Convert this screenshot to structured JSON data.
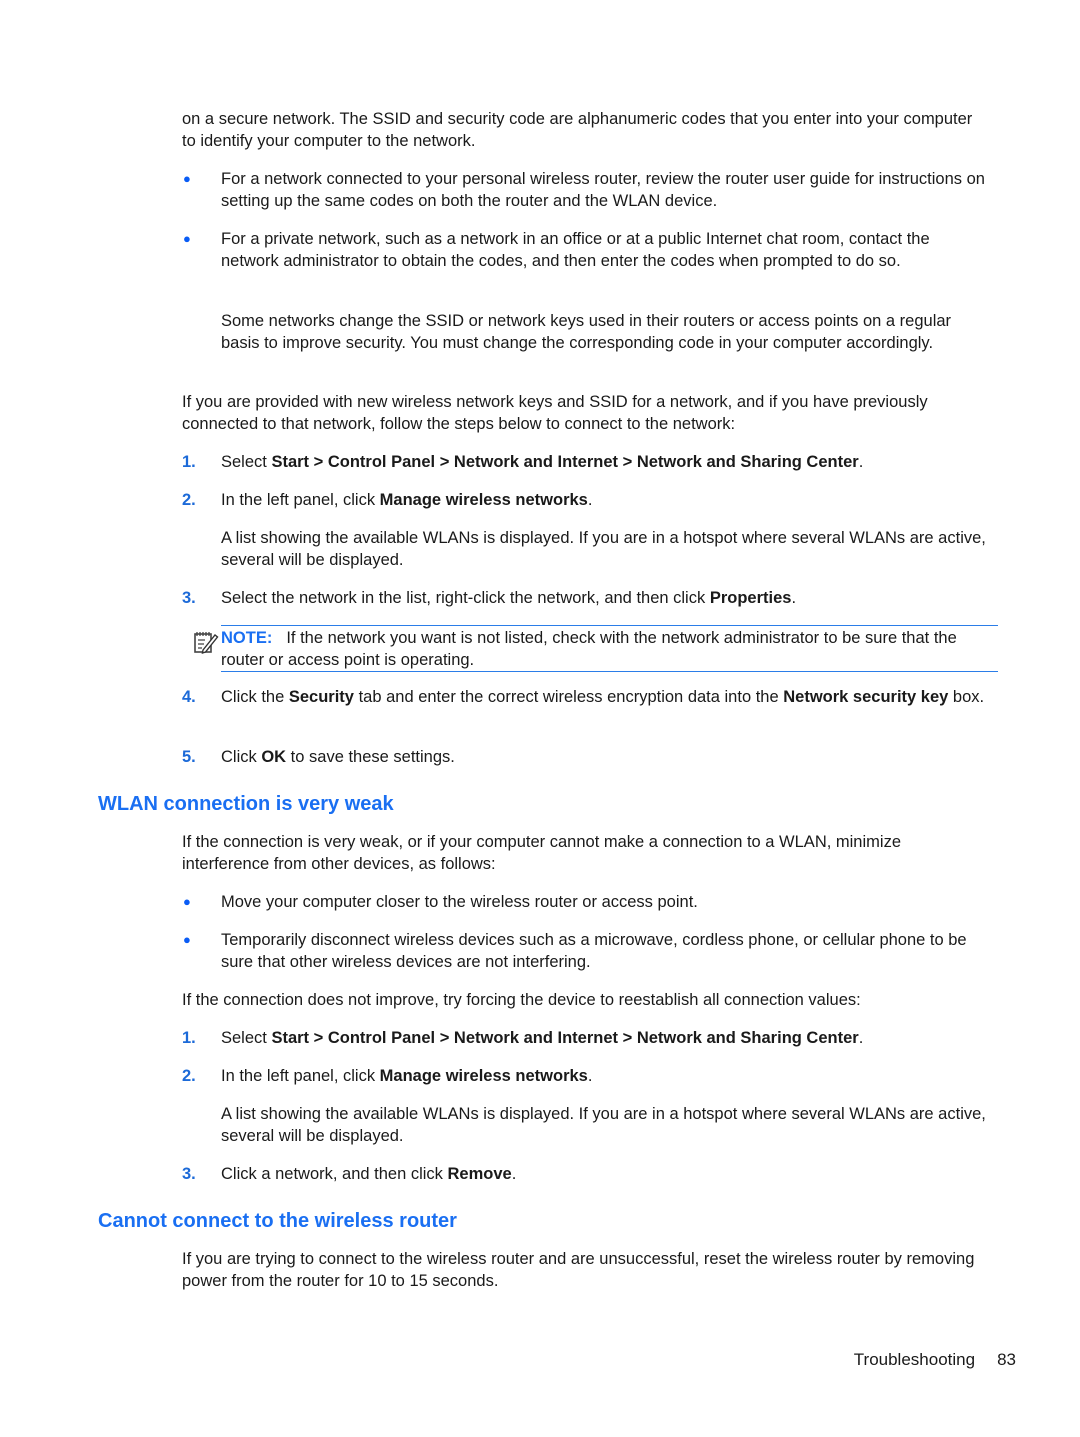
{
  "intro": {
    "paragraph": "on a secure network. The SSID and security code are alphanumeric codes that you enter into your computer to identify your computer to the network.",
    "bullets": [
      "For a network connected to your personal wireless router, review the router user guide for instructions on setting up the same codes on both the router and the WLAN device.",
      "For a private network, such as a network in an office or at a public Internet chat room, contact the network administrator to obtain the codes, and then enter the codes when prompted to do so."
    ],
    "sub_paragraph": "Some networks change the SSID or network keys used in their routers or access points on a regular basis to improve security. You must change the corresponding code in your computer accordingly.",
    "lead_in": "If you are provided with new wireless network keys and SSID for a network, and if you have previously connected to that network, follow the steps below to connect to the network:"
  },
  "steps_a": [
    {
      "num": "1.",
      "pre": "Select ",
      "bold": "Start > Control Panel > Network and Internet > Network and Sharing Center",
      "post": "."
    },
    {
      "num": "2.",
      "pre": "In the left panel, click ",
      "bold": "Manage wireless networks",
      "post": "."
    },
    {
      "detail": "A list showing the available WLANs is displayed. If you are in a hotspot where several WLANs are active, several will be displayed."
    },
    {
      "num": "3.",
      "pre": "Select the network in the list, right-click the network, and then click ",
      "bold": "Properties",
      "post": "."
    },
    {
      "num": "4.",
      "pre": "Click the ",
      "bold": "Security",
      "mid": " tab and enter the correct wireless encryption data into the ",
      "bold2": "Network security key",
      "post": " box."
    },
    {
      "num": "5.",
      "pre": "Click ",
      "bold": "OK",
      "post": " to save these settings."
    }
  ],
  "note": {
    "icon": "note-pad-pencil-icon",
    "label": "NOTE:",
    "text": "If the network you want is not listed, check with the network administrator to be sure that the router or access point is operating."
  },
  "section_weak": {
    "heading": "WLAN connection is very weak",
    "intro": "If the connection is very weak, or if your computer cannot make a connection to a WLAN, minimize interference from other devices, as follows:",
    "bullets": [
      "Move your computer closer to the wireless router or access point.",
      "Temporarily disconnect wireless devices such as a microwave, cordless phone, or cellular phone to be sure that other wireless devices are not interfering."
    ],
    "lead_in": "If the connection does not improve, try forcing the device to reestablish all connection values:",
    "steps": [
      {
        "num": "1.",
        "pre": "Select ",
        "bold": "Start > Control Panel > Network and Internet > Network and Sharing Center",
        "post": "."
      },
      {
        "num": "2.",
        "pre": "In the left panel, click ",
        "bold": "Manage wireless networks",
        "post": "."
      },
      {
        "detail": "A list showing the available WLANs is displayed. If you are in a hotspot where several WLANs are active, several will be displayed."
      },
      {
        "num": "3.",
        "pre": "Click a network, and then click ",
        "bold": "Remove",
        "post": "."
      }
    ]
  },
  "section_router": {
    "heading": "Cannot connect to the wireless router",
    "paragraph": "If you are trying to connect to the wireless router and are unsuccessful, reset the wireless router by removing power from the router for 10 to 15 seconds."
  },
  "footer": {
    "section": "Troubleshooting",
    "page_number": "83"
  },
  "colors": {
    "heading": "#1a6ff2",
    "step_number": "#1c6ad8",
    "bullet": "#0a5cf5",
    "rule": "#2b7de8"
  }
}
